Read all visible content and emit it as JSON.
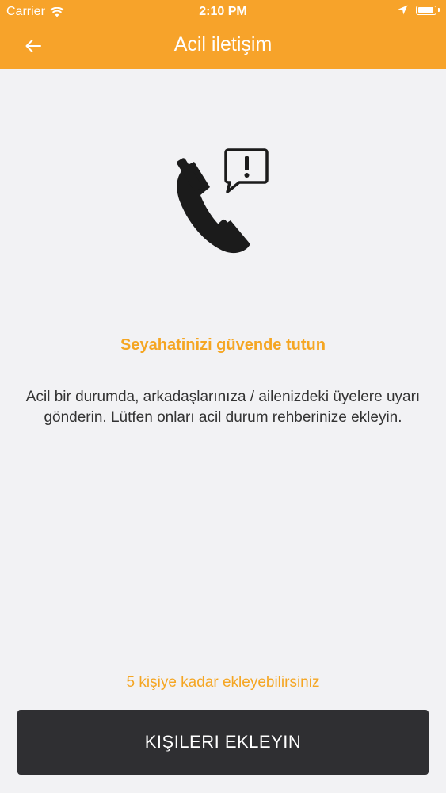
{
  "status_bar": {
    "carrier": "Carrier",
    "time": "2:10 PM",
    "icons": [
      "wifi-icon",
      "location-arrow-icon",
      "battery-icon"
    ]
  },
  "nav_bar": {
    "title": "Acil iletişim",
    "back_icon": "arrow-left-icon"
  },
  "hero": {
    "icon": "phone-alert-icon"
  },
  "main": {
    "heading": "Seyahatinizi güvende tutun",
    "description": "Acil bir durumda, arkadaşlarınıza / ailenizdeki üyelere uyarı gönderin. Lütfen onları acil durum rehberinize ekleyin.",
    "limit_note": "5 kişiye kadar ekleyebilirsiniz",
    "add_button_label": "KIŞILERI EKLEYIN"
  },
  "colors": {
    "accent": "#f7a32a",
    "background": "#f2f2f4",
    "button": "#2f2f32",
    "text": "#333333"
  }
}
